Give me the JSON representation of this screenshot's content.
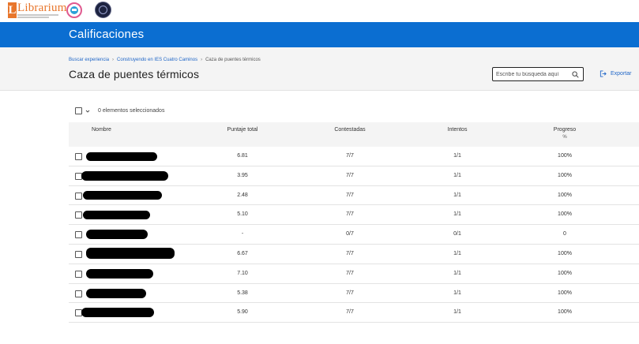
{
  "logo": {
    "brand": "Librarium",
    "letter": "L"
  },
  "header": {
    "title": "Calificaciones"
  },
  "breadcrumb": {
    "items": [
      "Buscar experiencia",
      "Construyendo en IES Cuatro Caminos",
      "Caza de puentes térmicos"
    ]
  },
  "page": {
    "title": "Caza de puentes térmicos"
  },
  "search": {
    "placeholder": "Escribe tu búsqueda aquí",
    "value": ""
  },
  "export": {
    "label": "Exportar"
  },
  "selection": {
    "label": "0 elementos seleccionados"
  },
  "table": {
    "columns": {
      "name": "Nombre",
      "score": "Puntaje total",
      "answered": "Contestadas",
      "attempts": "Intentos",
      "progress": "Progreso",
      "progress_unit": "%"
    },
    "rows": [
      {
        "score": "6.81",
        "answered": "7/7",
        "attempts": "1/1",
        "progress": "100%"
      },
      {
        "score": "3.95",
        "answered": "7/7",
        "attempts": "1/1",
        "progress": "100%"
      },
      {
        "score": "2.48",
        "answered": "7/7",
        "attempts": "1/1",
        "progress": "100%"
      },
      {
        "score": "5.10",
        "answered": "7/7",
        "attempts": "1/1",
        "progress": "100%"
      },
      {
        "score": "-",
        "answered": "0/7",
        "attempts": "0/1",
        "progress": "0"
      },
      {
        "score": "6.67",
        "answered": "7/7",
        "attempts": "1/1",
        "progress": "100%"
      },
      {
        "score": "7.10",
        "answered": "7/7",
        "attempts": "1/1",
        "progress": "100%"
      },
      {
        "score": "5.38",
        "answered": "7/7",
        "attempts": "1/1",
        "progress": "100%"
      },
      {
        "score": "5.90",
        "answered": "7/7",
        "attempts": "1/1",
        "progress": "100%"
      }
    ]
  },
  "colors": {
    "header_bg": "#0b6ed1",
    "brand_orange": "#e8762c",
    "link": "#1f66c7"
  }
}
